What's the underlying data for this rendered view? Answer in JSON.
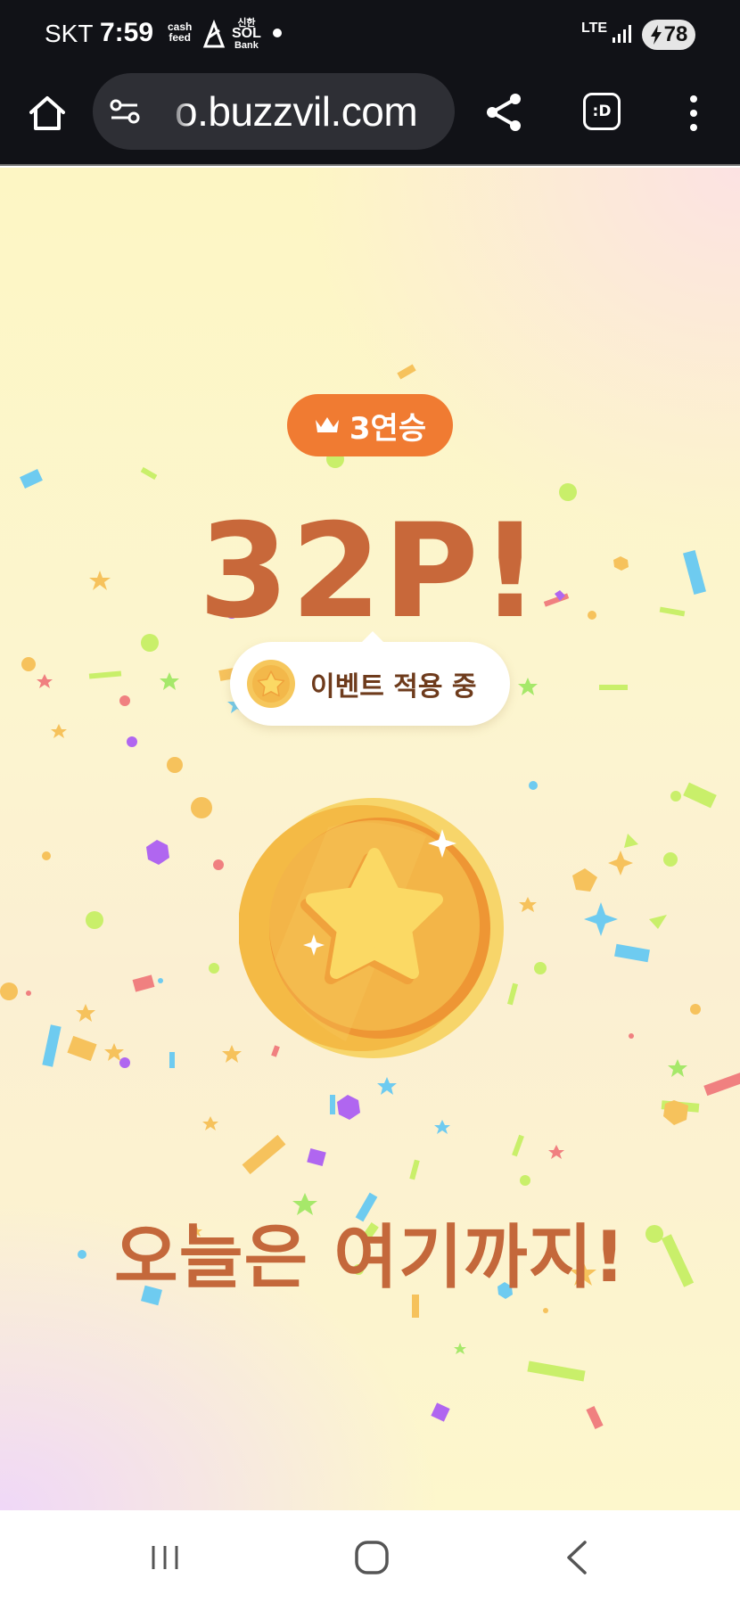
{
  "status_bar": {
    "carrier": "SKT",
    "time": "7:59",
    "app_icons": [
      "cash feed",
      "신한 SOL Bank"
    ],
    "network": "LTE",
    "battery": "78"
  },
  "browser": {
    "url": "o.buzzvil.com",
    "dex_label": ":D"
  },
  "reward": {
    "streak_label": "3연승",
    "points": "32P!",
    "event_label": "이벤트 적용 중",
    "message": "오늘은 여기까지!"
  },
  "colors": {
    "accent_orange": "#f07b32",
    "points_brown": "#c8683a",
    "coin_gold": "#f3b84a"
  }
}
